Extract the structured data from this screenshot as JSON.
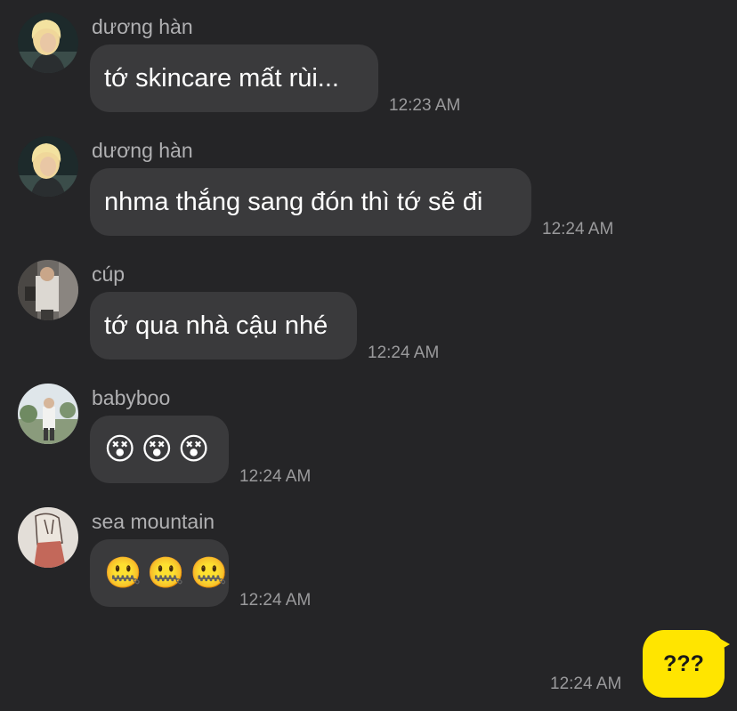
{
  "messages": [
    {
      "sender": "dương hàn",
      "text": "tớ skincare mất rùi...",
      "time": "12:23 AM",
      "avatar": "blonde-person-avatar"
    },
    {
      "sender": "dương hàn",
      "text": "nhma thắng sang đón thì tớ sẽ đi",
      "time": "12:24 AM",
      "avatar": "blonde-person-avatar"
    },
    {
      "sender": "cúp",
      "text": "tớ qua nhà cậu nhé",
      "time": "12:24 AM",
      "avatar": "mirror-selfie-avatar"
    },
    {
      "sender": "babyboo",
      "text": "😵😵😵",
      "time": "12:24 AM",
      "avatar": "outdoor-person-avatar"
    },
    {
      "sender": "sea mountain",
      "text": "🤐🤐🤐",
      "time": "12:24 AM",
      "avatar": "drawn-figure-avatar"
    }
  ],
  "my_message": {
    "text": "???",
    "time": "12:24 AM",
    "bubble_color": "#ffe500"
  },
  "colors": {
    "background": "#252527",
    "bubble": "#3a3a3c",
    "name": "#b0b0b2",
    "time": "#9a9a9c"
  }
}
